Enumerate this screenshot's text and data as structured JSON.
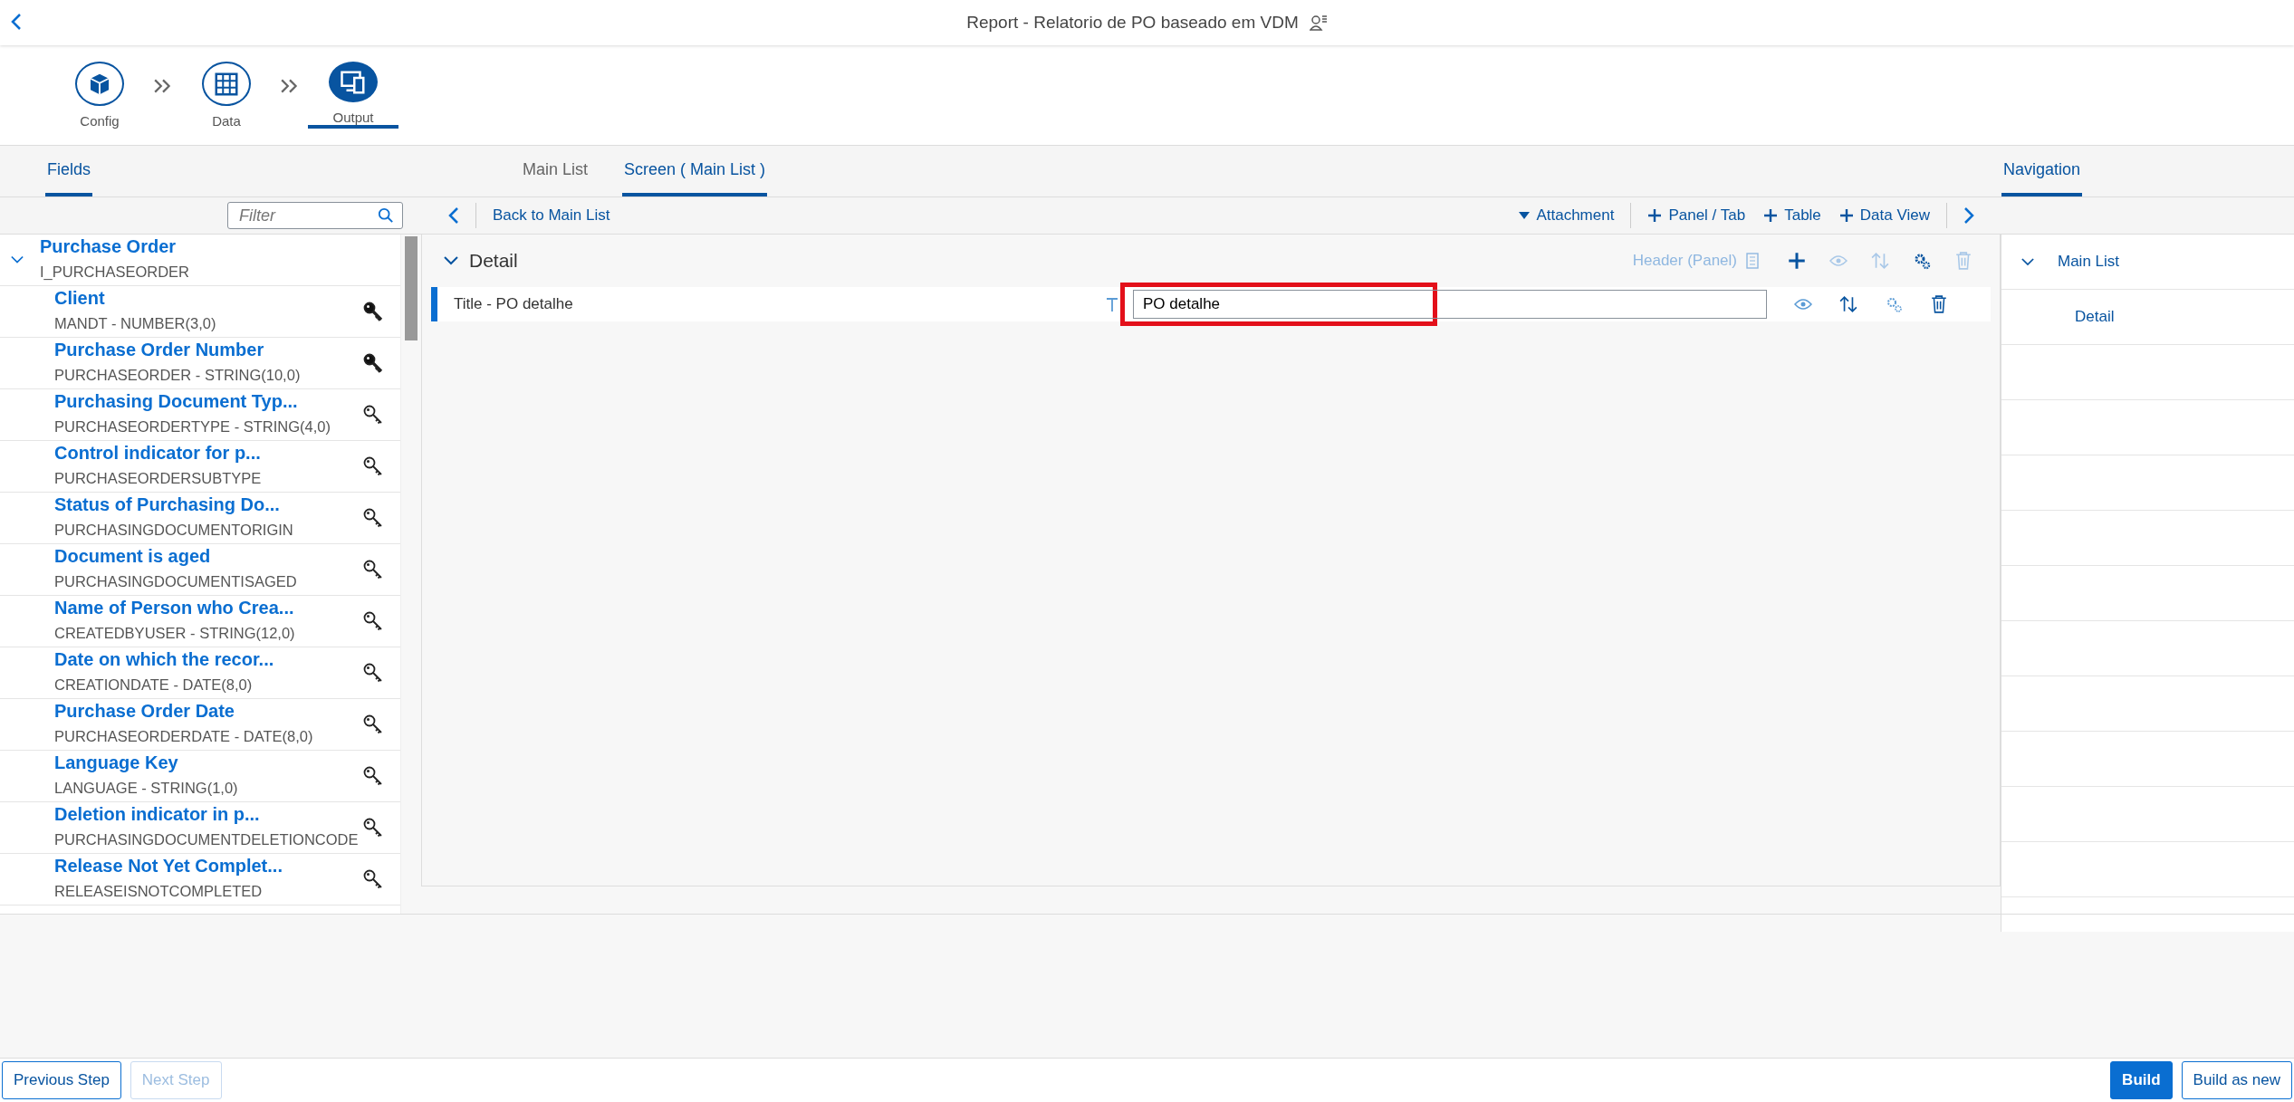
{
  "window": {
    "title": "Report - Relatorio de PO baseado em VDM"
  },
  "steps": [
    {
      "label": "Config",
      "kind": "config",
      "selected": false
    },
    {
      "label": "Data",
      "kind": "data",
      "selected": false
    },
    {
      "label": "Output",
      "kind": "output",
      "selected": true
    }
  ],
  "left_tabs": [
    {
      "label": "Fields",
      "selected": true
    }
  ],
  "center_tabs": [
    {
      "label": "Main List",
      "selected": false
    },
    {
      "label": "Screen ( Main List )",
      "selected": true
    }
  ],
  "right_tabs": [
    {
      "label": "Navigation",
      "selected": true
    }
  ],
  "filter": {
    "placeholder": "Filter"
  },
  "fields": {
    "title": "Purchase Order",
    "name": "I_PURCHASEORDER",
    "expanded": true,
    "items": [
      {
        "label": "Client",
        "tech": "MANDT - NUMBER(3,0)",
        "key": true
      },
      {
        "label": "Purchase Order Number",
        "tech": "PURCHASEORDER - STRING(10,0)",
        "key": true
      },
      {
        "label": "Purchasing Document Typ...",
        "tech": "PURCHASEORDERTYPE - STRING(4,0)",
        "key": false
      },
      {
        "label": "Control indicator for p...",
        "tech": "PURCHASEORDERSUBTYPE",
        "key": false
      },
      {
        "label": "Status of Purchasing Do...",
        "tech": "PURCHASINGDOCUMENTORIGIN",
        "key": false
      },
      {
        "label": "Document is aged",
        "tech": "PURCHASINGDOCUMENTISAGED",
        "key": false
      },
      {
        "label": "Name of Person who Crea...",
        "tech": "CREATEDBYUSER - STRING(12,0)",
        "key": false
      },
      {
        "label": "Date on which the recor...",
        "tech": "CREATIONDATE - DATE(8,0)",
        "key": false
      },
      {
        "label": "Purchase Order Date",
        "tech": "PURCHASEORDERDATE - DATE(8,0)",
        "key": false
      },
      {
        "label": "Language Key",
        "tech": "LANGUAGE - STRING(1,0)",
        "key": false
      },
      {
        "label": "Deletion indicator in p...",
        "tech": "PURCHASINGDOCUMENTDELETIONCODE",
        "key": false
      },
      {
        "label": "Release Not Yet Complet...",
        "tech": "RELEASEISNOTCOMPLETED",
        "key": false
      }
    ]
  },
  "toolbar": {
    "back": "Back to Main List",
    "actions": [
      {
        "label": "Attachment",
        "kind": "menu"
      },
      {
        "label": "Panel / Tab",
        "kind": "add"
      },
      {
        "label": "Table",
        "kind": "add"
      },
      {
        "label": "Data View",
        "kind": "add"
      }
    ]
  },
  "section": {
    "title": "Detail",
    "expanded": true,
    "header_action": "Header (Panel)",
    "rows": [
      {
        "label": "Title - PO detalhe",
        "value": "PO detalhe",
        "highlighted": true
      }
    ]
  },
  "navigation": [
    {
      "label": "Main List",
      "expanded": true,
      "children": [
        {
          "label": "Detail"
        }
      ]
    }
  ],
  "footer": {
    "left": [
      {
        "label": "Previous Step",
        "disabled": false
      },
      {
        "label": "Next Step",
        "disabled": true
      }
    ],
    "right": [
      {
        "label": "Build",
        "kind": "primary"
      },
      {
        "label": "Build as new",
        "kind": "default"
      }
    ]
  }
}
